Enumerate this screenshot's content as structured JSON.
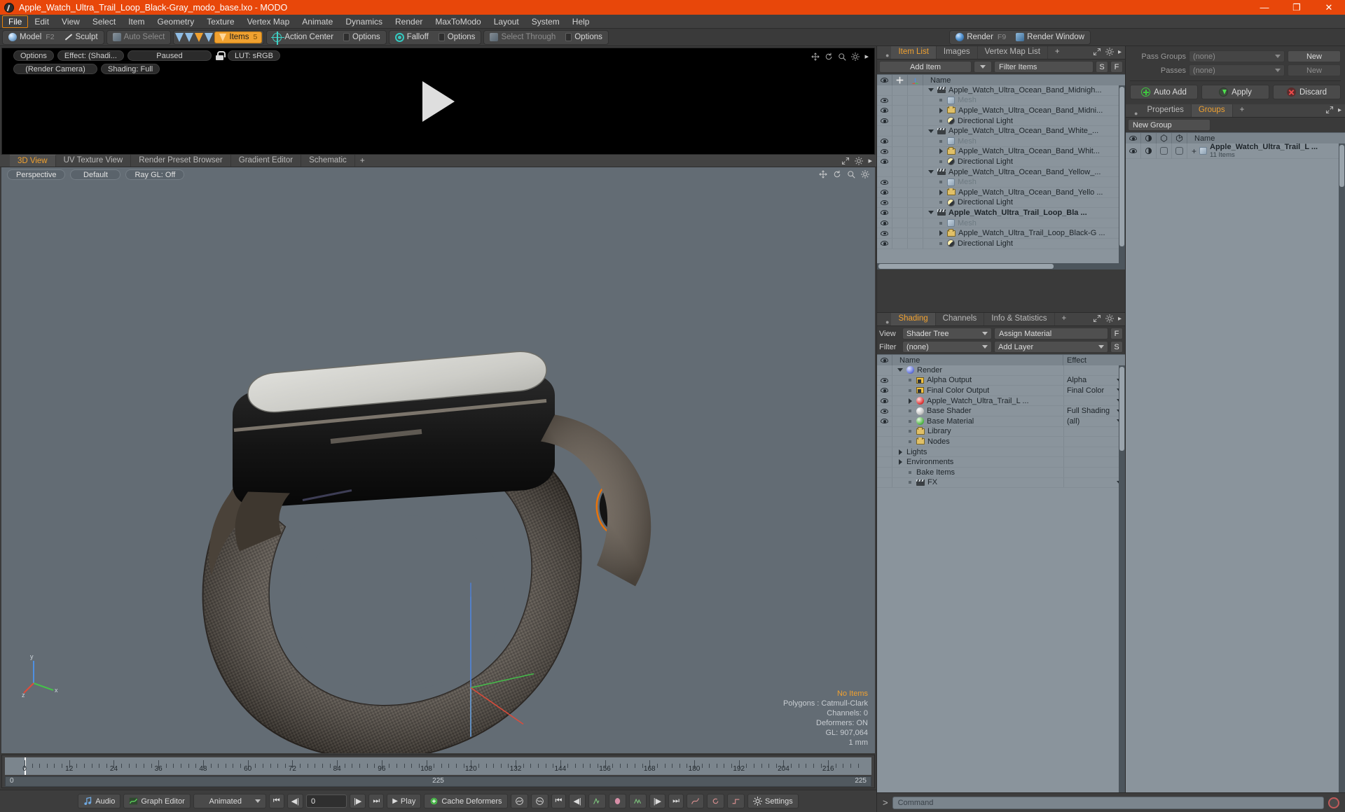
{
  "window": {
    "title": "Apple_Watch_Ultra_Trail_Loop_Black-Gray_modo_base.lxo - MODO",
    "minimize": "—",
    "maximize": "❐",
    "close": "✕"
  },
  "menubar": {
    "items": [
      "File",
      "Edit",
      "View",
      "Select",
      "Item",
      "Geometry",
      "Texture",
      "Vertex Map",
      "Animate",
      "Dynamics",
      "Render",
      "MaxToModo",
      "Layout",
      "System",
      "Help"
    ],
    "active": "File"
  },
  "toolbar": {
    "model": "Model",
    "model_key": "F2",
    "sculpt": "Sculpt",
    "auto_select": "Auto Select",
    "items": "Items",
    "items_key": "5",
    "action_center": "Action Center",
    "options1": "Options",
    "falloff": "Falloff",
    "options2": "Options",
    "select_through": "Select Through",
    "options3": "Options",
    "render": "Render",
    "render_key": "F9",
    "render_window": "Render Window"
  },
  "render_preview": {
    "options": "Options",
    "effect": "Effect: (Shadi...",
    "paused": "Paused",
    "lut": "LUT: sRGB",
    "camera": "(Render Camera)",
    "shading": "Shading: Full"
  },
  "viewport": {
    "tabs": [
      "3D View",
      "UV Texture View",
      "Render Preset Browser",
      "Gradient Editor",
      "Schematic"
    ],
    "selected_tab": "3D View",
    "add_tab": "+",
    "controls": [
      "Perspective",
      "Default",
      "Ray GL: Off"
    ],
    "stats": {
      "selection": "No Items",
      "polygons": "Polygons : Catmull-Clark",
      "channels": "Channels: 0",
      "deformers": "Deformers: ON",
      "gl": "GL: 907,064",
      "unit": "1 mm"
    }
  },
  "timeline": {
    "ticks": [
      0,
      12,
      24,
      36,
      48,
      60,
      72,
      84,
      96,
      108,
      120,
      132,
      144,
      156,
      168,
      180,
      192,
      204,
      216
    ],
    "range_start": "0",
    "range_mid": "225",
    "range_end": "225"
  },
  "transport": {
    "audio": "Audio",
    "graph_editor": "Graph Editor",
    "animated": "Animated",
    "frame": "0",
    "play": "Play",
    "cache_deformers": "Cache Deformers",
    "settings": "Settings"
  },
  "item_list": {
    "tabs": [
      "Item List",
      "Images",
      "Vertex Map List"
    ],
    "selected_tab": "Item List",
    "add_tab": "+",
    "add_item": "Add Item",
    "filter_items": "Filter Items",
    "btn_s": "S",
    "btn_f": "F",
    "col_name": "Name",
    "rows": [
      {
        "label": "Apple_Watch_Ultra_Ocean_Band_Midnigh...",
        "icon": "clapperboard-icon",
        "depth": 0,
        "tri": "down",
        "eye": false,
        "bold": false,
        "dim": false
      },
      {
        "label": "Mesh",
        "icon": "mesh-icon",
        "depth": 1,
        "tri": "none",
        "eye": true,
        "bold": false,
        "dim": true
      },
      {
        "label": "Apple_Watch_Ultra_Ocean_Band_Midni...",
        "icon": "folder-icon",
        "depth": 1,
        "tri": "right",
        "eye": true,
        "bold": false,
        "dim": false
      },
      {
        "label": "Directional Light",
        "icon": "light-icon",
        "depth": 1,
        "tri": "none",
        "eye": true,
        "bold": false,
        "dim": false
      },
      {
        "label": "Apple_Watch_Ultra_Ocean_Band_White_...",
        "icon": "clapperboard-icon",
        "depth": 0,
        "tri": "down",
        "eye": false,
        "bold": false,
        "dim": false
      },
      {
        "label": "Mesh",
        "icon": "mesh-icon",
        "depth": 1,
        "tri": "none",
        "eye": true,
        "bold": false,
        "dim": true
      },
      {
        "label": "Apple_Watch_Ultra_Ocean_Band_Whit...",
        "icon": "folder-icon",
        "depth": 1,
        "tri": "right",
        "eye": true,
        "bold": false,
        "dim": false
      },
      {
        "label": "Directional Light",
        "icon": "light-icon",
        "depth": 1,
        "tri": "none",
        "eye": true,
        "bold": false,
        "dim": false
      },
      {
        "label": "Apple_Watch_Ultra_Ocean_Band_Yellow_...",
        "icon": "clapperboard-icon",
        "depth": 0,
        "tri": "down",
        "eye": false,
        "bold": false,
        "dim": false
      },
      {
        "label": "Mesh",
        "icon": "mesh-icon",
        "depth": 1,
        "tri": "none",
        "eye": true,
        "bold": false,
        "dim": true
      },
      {
        "label": "Apple_Watch_Ultra_Ocean_Band_Yello ...",
        "icon": "folder-icon",
        "depth": 1,
        "tri": "right",
        "eye": true,
        "bold": false,
        "dim": false
      },
      {
        "label": "Directional Light",
        "icon": "light-icon",
        "depth": 1,
        "tri": "none",
        "eye": true,
        "bold": false,
        "dim": false
      },
      {
        "label": "Apple_Watch_Ultra_Trail_Loop_Bla ...",
        "icon": "clapperboard-icon",
        "depth": 0,
        "tri": "down",
        "eye": true,
        "bold": true,
        "dim": false
      },
      {
        "label": "Mesh",
        "icon": "mesh-icon",
        "depth": 1,
        "tri": "none",
        "eye": true,
        "bold": false,
        "dim": true
      },
      {
        "label": "Apple_Watch_Ultra_Trail_Loop_Black-G ...",
        "icon": "folder-icon",
        "depth": 1,
        "tri": "right",
        "eye": true,
        "bold": false,
        "dim": false
      },
      {
        "label": "Directional Light",
        "icon": "light-icon",
        "depth": 1,
        "tri": "none",
        "eye": true,
        "bold": false,
        "dim": false
      }
    ]
  },
  "shading": {
    "tabs": [
      "Shading",
      "Channels",
      "Info & Statistics"
    ],
    "selected_tab": "Shading",
    "add_tab": "+",
    "view_label": "View",
    "view_value": "Shader Tree",
    "assign_material": "Assign Material",
    "btn_f": "F",
    "filter_label": "Filter",
    "filter_value": "(none)",
    "add_layer": "Add Layer",
    "btn_s": "S",
    "col_name": "Name",
    "col_effect": "Effect",
    "rows": [
      {
        "label": "Render",
        "effect": "",
        "icon": "sphere-blue-icon",
        "depth": 0,
        "tri": "down",
        "eye": false
      },
      {
        "label": "Alpha Output",
        "effect": "Alpha",
        "icon": "image-icon",
        "depth": 1,
        "tri": "none",
        "eye": true
      },
      {
        "label": "Final Color Output",
        "effect": "Final Color",
        "icon": "image-icon",
        "depth": 1,
        "tri": "none",
        "eye": true
      },
      {
        "label": "Apple_Watch_Ultra_Trail_L ...",
        "effect": "",
        "icon": "material-red-icon",
        "depth": 1,
        "tri": "right",
        "eye": true
      },
      {
        "label": "Base Shader",
        "effect": "Full Shading",
        "icon": "sphere-white-icon",
        "depth": 1,
        "tri": "none",
        "eye": true
      },
      {
        "label": "Base Material",
        "effect": "(all)",
        "icon": "material-green-icon",
        "depth": 1,
        "tri": "none",
        "eye": true
      },
      {
        "label": "Library",
        "effect": "",
        "icon": "folder-icon",
        "depth": 1,
        "tri": "none",
        "eye": false
      },
      {
        "label": "Nodes",
        "effect": "",
        "icon": "folder-icon",
        "depth": 1,
        "tri": "none",
        "eye": false
      },
      {
        "label": "Lights",
        "effect": "",
        "icon": "none",
        "depth": 0,
        "tri": "right",
        "eye": false
      },
      {
        "label": "Environments",
        "effect": "",
        "icon": "none",
        "depth": 0,
        "tri": "right",
        "eye": false
      },
      {
        "label": "Bake Items",
        "effect": "",
        "icon": "none",
        "depth": 1,
        "tri": "none",
        "eye": false
      },
      {
        "label": "FX",
        "effect": "",
        "icon": "clapperboard-icon",
        "depth": 1,
        "tri": "none",
        "eye": false
      }
    ]
  },
  "passes": {
    "pass_groups_label": "Pass Groups",
    "pass_groups_value": "(none)",
    "pass_groups_new": "New",
    "passes_label": "Passes",
    "passes_value": "(none)",
    "passes_new": "New",
    "auto_add": "Auto Add",
    "apply": "Apply",
    "discard": "Discard"
  },
  "groups": {
    "tabs": [
      "Properties",
      "Groups"
    ],
    "selected_tab": "Groups",
    "add_tab": "+",
    "new_group": "New Group",
    "col_name": "Name",
    "rows": [
      {
        "label": "Apple_Watch_Ultra_Trail_L ...",
        "sub": "11 Items"
      }
    ]
  },
  "command": {
    "placeholder": "Command",
    "prompt": ">"
  }
}
